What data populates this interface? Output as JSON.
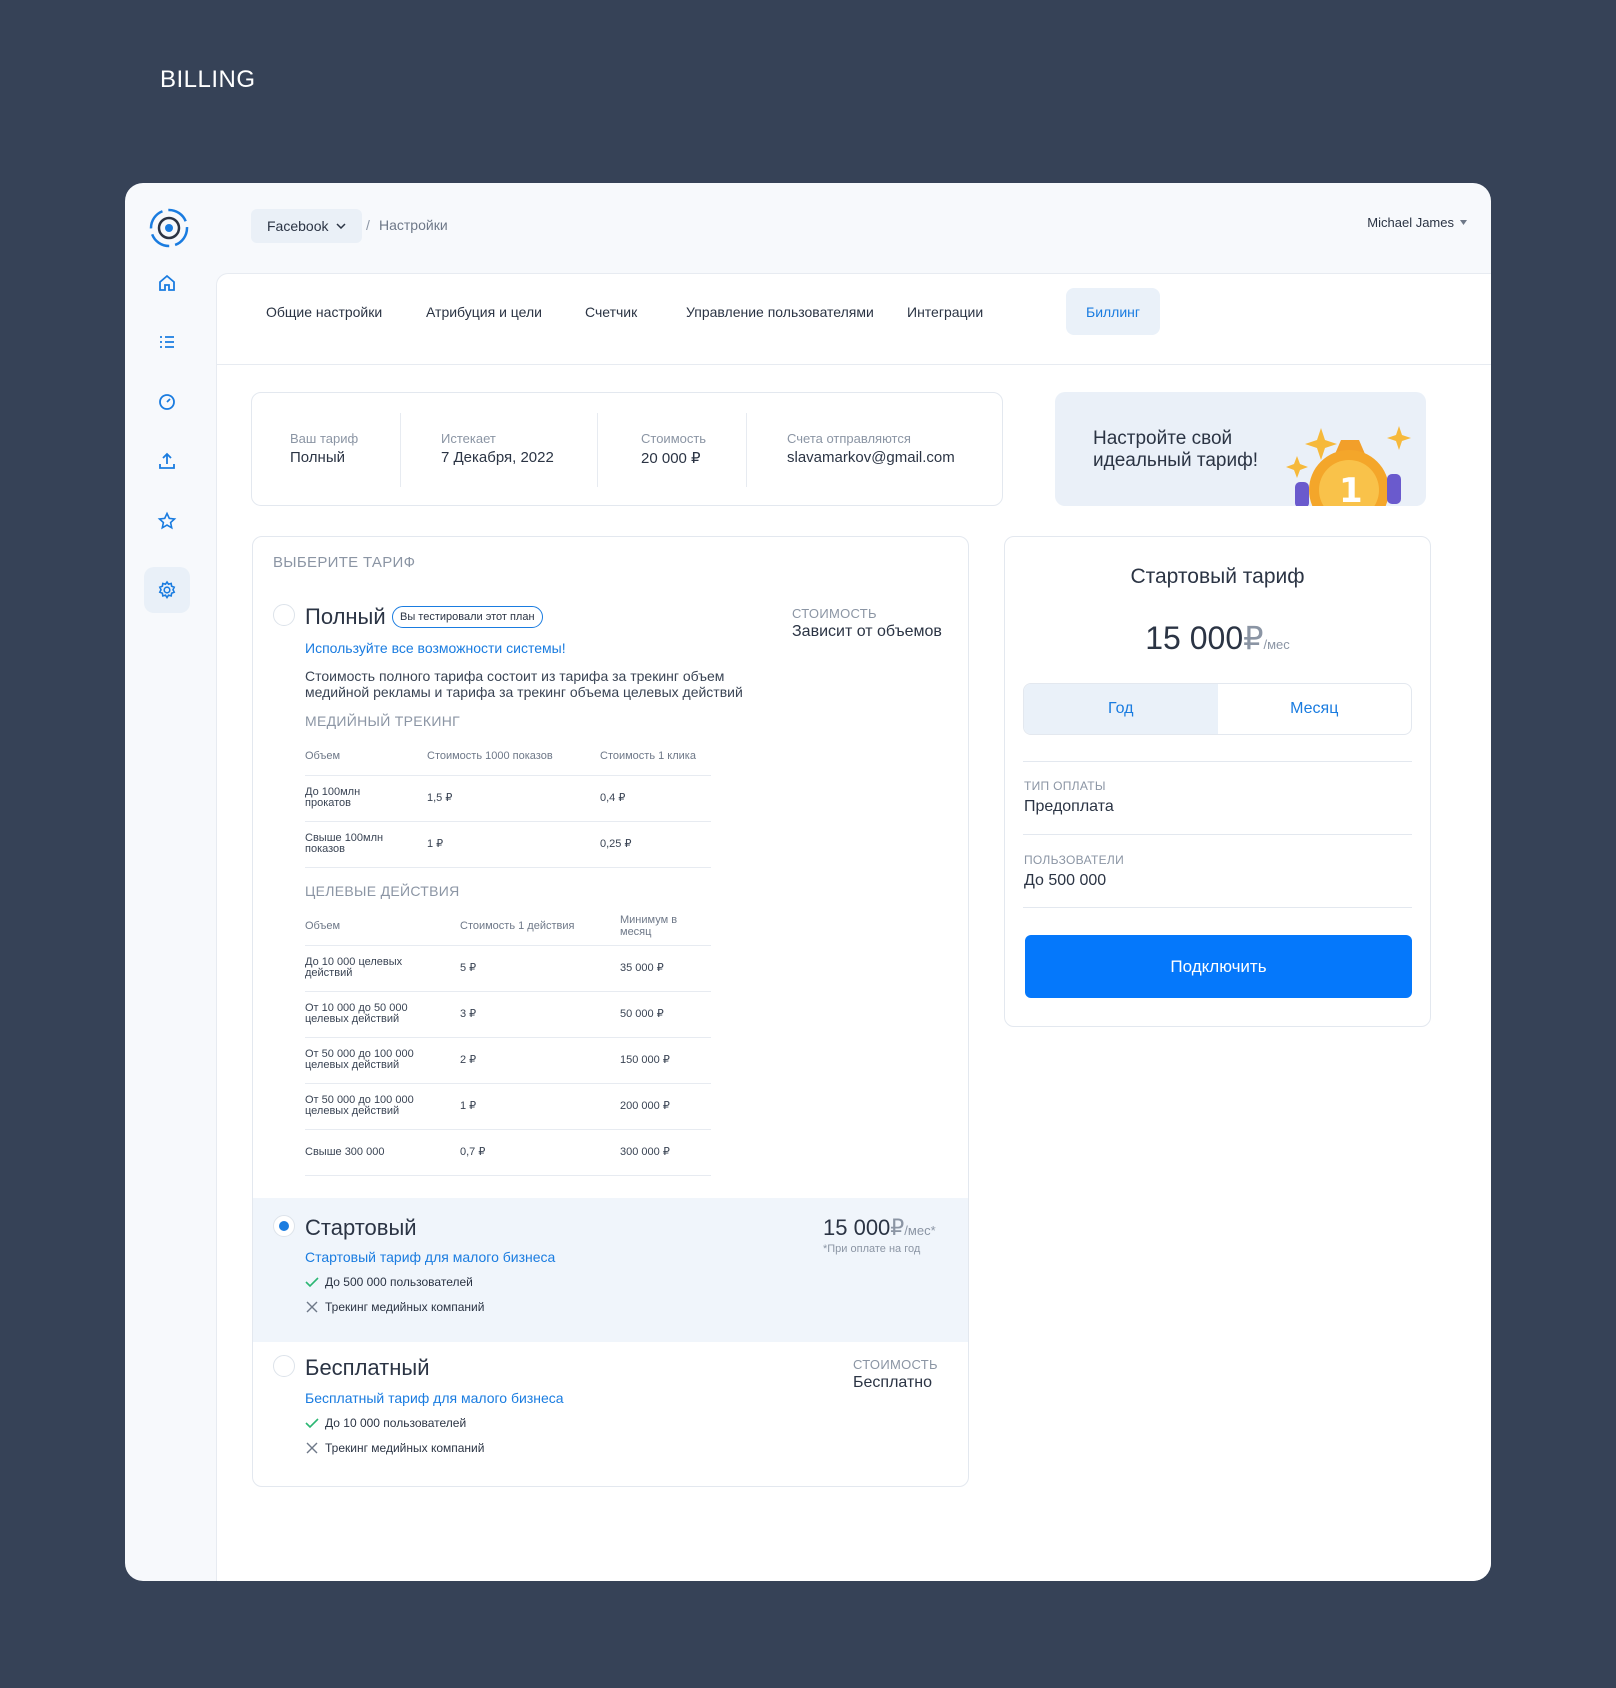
{
  "page_heading": "BILLING",
  "topbar": {
    "project": "Facebook",
    "separator": "/",
    "current": "Настройки",
    "user": "Michael James"
  },
  "tabs": [
    {
      "label": "Общие настройки"
    },
    {
      "label": "Атрибуция и цели"
    },
    {
      "label": "Счетчик"
    },
    {
      "label": "Управление пользователями"
    },
    {
      "label": "Интеграции"
    },
    {
      "label": "Биллинг"
    }
  ],
  "summary": {
    "plan_label": "Ваш тариф",
    "plan_value": "Полный",
    "expires_label": "Истекает",
    "expires_value": "7 Декабря, 2022",
    "cost_label": "Стоимость",
    "cost_value": "20 000 ₽",
    "invoices_label": "Счета отправляются",
    "invoices_value": "slavamarkov@gmail.com"
  },
  "promo": {
    "text": "Настройте свой идеальный тариф!",
    "medal_number": "1"
  },
  "plans": {
    "title": "ВЫБЕРИТЕ ТАРИФ",
    "full": {
      "name": "Полный",
      "badge": "Вы тестировали этот план",
      "subtitle": "Используйте все возможности системы!",
      "description": "Стоимость полного тарифа состоит из тарифа за трекинг объем медийной рекламы и тарифа за трекинг объема целевых действий",
      "price_label": "СТОИМОСТЬ",
      "price_value": "Зависит от объемов",
      "media_title": "МЕДИЙНЫЙ ТРЕКИНГ",
      "media_headers": [
        "Объем",
        "Стоимость 1000 показов",
        "Стоимость 1 клика"
      ],
      "media_rows": [
        [
          "До 100млн\nпрокатов",
          "1,5 ₽",
          "0,4 ₽"
        ],
        [
          "Свыше 100млн\nпоказов",
          "1 ₽",
          "0,25 ₽"
        ]
      ],
      "actions_title": "ЦЕЛЕВЫЕ ДЕЙСТВИЯ",
      "actions_headers": [
        "Объем",
        "Стоимость 1 действия",
        "Минимум в месяц"
      ],
      "actions_rows": [
        [
          "До 10 000 целевых\nдействий",
          "5 ₽",
          "35 000 ₽"
        ],
        [
          "От 10 000 до 50 000\nцелевых действий",
          "3 ₽",
          "50 000 ₽"
        ],
        [
          "От 50 000 до 100 000\nцелевых действий",
          "2 ₽",
          "150 000 ₽"
        ],
        [
          "От 50 000 до 100 000\nцелевых действий",
          "1 ₽",
          "200 000 ₽"
        ],
        [
          "Свыше 300 000",
          "0,7 ₽",
          "300 000 ₽"
        ]
      ]
    },
    "start": {
      "name": "Стартовый",
      "subtitle": "Стартовый тариф для малого бизнеса",
      "feature_yes": "До 500 000 пользователей",
      "feature_no": "Трекинг медийных компаний",
      "price": "15 000",
      "currency": "₽",
      "unit": "/мес*",
      "note": "*При оплате на год"
    },
    "free": {
      "name": "Бесплатный",
      "subtitle": "Бесплатный тариф для малого бизнеса",
      "feature_yes": "До 10 000 пользователей",
      "feature_no": "Трекинг медийных компаний",
      "price_label": "СТОИМОСТЬ",
      "price_value": "Бесплатно"
    }
  },
  "card": {
    "title": "Стартовый тариф",
    "price": "15 000",
    "currency": "₽",
    "unit": "/мес",
    "period_year": "Год",
    "period_month": "Месяц",
    "payment_label": "ТИП ОПЛАТЫ",
    "payment_value": "Предоплата",
    "users_label": "ПОЛЬЗОВАТЕЛИ",
    "users_value": "До 500 000",
    "cta": "Подключить"
  },
  "colors": {
    "accent": "#0578fb",
    "link": "#1a7ce0",
    "background": "#364257",
    "check": "#2bb673"
  },
  "icons": [
    "logo-icon",
    "home-icon",
    "list-icon",
    "gauge-icon",
    "upload-icon",
    "star-icon",
    "gear-icon"
  ]
}
